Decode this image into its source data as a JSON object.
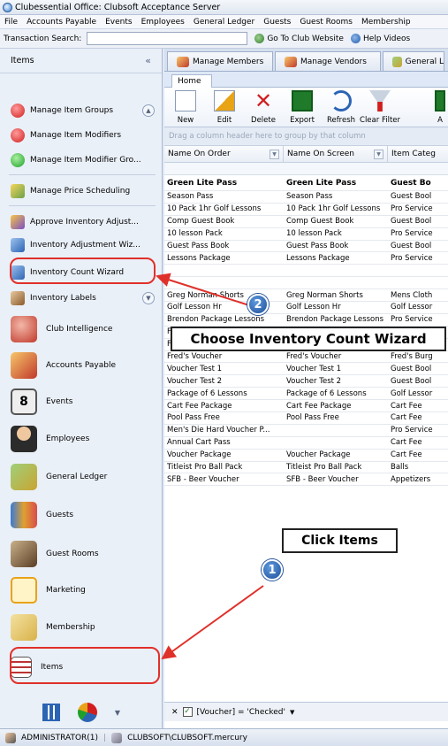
{
  "window": {
    "title": "Clubessential Office: Clubsoft Acceptance Server"
  },
  "menu": [
    "File",
    "Accounts Payable",
    "Events",
    "Employees",
    "General Ledger",
    "Guests",
    "Guest Rooms",
    "Membership"
  ],
  "toolbar": {
    "transaction_search_label": "Transaction Search:",
    "transaction_search_value": "",
    "go_to_website": "Go To Club Website",
    "help_videos": "Help Videos"
  },
  "sidebar": {
    "header": "Items",
    "collapse_glyph": "«",
    "items": [
      {
        "label": "Manage Item Groups",
        "icon": "red-circle-icon"
      },
      {
        "label": "Manage Item Modifiers",
        "icon": "red-circle-icon"
      },
      {
        "label": "Manage Item Modifier Gro...",
        "icon": "green-circle-icon"
      },
      {
        "label": "Manage Price Scheduling",
        "icon": "price-icon"
      },
      {
        "label": "Approve Inventory Adjust...",
        "icon": "pencil-check-icon"
      },
      {
        "label": "Inventory Adjustment Wiz...",
        "icon": "wizard-icon"
      },
      {
        "label": "Inventory Count Wizard",
        "icon": "wizard-icon"
      },
      {
        "label": "Inventory Labels",
        "icon": "label-icon"
      }
    ],
    "groups": [
      {
        "label": "Club Intelligence",
        "icon": "club-intelligence-icon",
        "color": "#c0392b"
      },
      {
        "label": "Accounts Payable",
        "icon": "accounts-payable-icon",
        "color": "#e08a1e"
      },
      {
        "label": "Events",
        "icon": "events-calendar-icon",
        "color": "#6b6b6b"
      },
      {
        "label": "Employees",
        "icon": "employees-icon",
        "color": "#2b2b2b"
      },
      {
        "label": "General Ledger",
        "icon": "general-ledger-icon",
        "color": "#c9a431"
      },
      {
        "label": "Guests",
        "icon": "guests-icon",
        "color": "#3a7bd5"
      },
      {
        "label": "Guest Rooms",
        "icon": "guest-rooms-icon",
        "color": "#7a5a3a"
      },
      {
        "label": "Marketing",
        "icon": "marketing-icon",
        "color": "#e8a317"
      },
      {
        "label": "Membership",
        "icon": "membership-icon",
        "color": "#d9b24a"
      },
      {
        "label": "Items",
        "icon": "items-icon",
        "color": "#8a6a4a"
      }
    ]
  },
  "doc_tabs": [
    "Manage Members",
    "Manage Vendors",
    "General L"
  ],
  "ribbon": {
    "tab": "Home",
    "buttons": [
      "New",
      "Edit",
      "Delete",
      "Export",
      "Refresh",
      "Clear Filter",
      "A"
    ]
  },
  "grid": {
    "group_hint": "Drag a column header here to group by that column",
    "columns": [
      "Name On Order",
      "Name On Screen",
      "Item Categ"
    ],
    "header_row": [
      "Green Lite Pass",
      "Green Lite Pass",
      "Guest Bo"
    ],
    "rows": [
      [
        "Season Pass",
        "Season Pass",
        "Guest Bool"
      ],
      [
        "10 Pack 1hr Golf Lessons",
        "10 Pack 1hr Golf Lessons",
        "Pro Service"
      ],
      [
        "Comp Guest Book",
        "Comp Guest Book",
        "Guest Bool"
      ],
      [
        "10 lesson Pack",
        "10 lesson Pack",
        "Pro Service"
      ],
      [
        "Guest Pass Book",
        "Guest Pass Book",
        "Guest Bool"
      ],
      [
        "Lessons Package",
        "Lessons Package",
        "Pro Service"
      ],
      [
        "",
        "",
        ""
      ],
      [
        "",
        "",
        ""
      ],
      [
        "Greg Norman Shorts",
        "Greg Norman Shorts",
        "Mens Cloth"
      ],
      [
        "Golf Lesson Hr",
        "Golf Lesson Hr",
        "Golf Lessor"
      ],
      [
        "Brendon Package Lessons",
        "Brendon Package Lessons",
        "Pro Service"
      ],
      [
        "Fitness Classes - Pkg 10",
        "Fitness Classes - Pkg 10",
        "Fitness"
      ],
      [
        "Fitness Class - Pkg 20",
        "Fitness Class - Pkg 20",
        "Fitness"
      ],
      [
        "Fred's Voucher",
        "Fred's Voucher",
        "Fred's Burg"
      ],
      [
        "Voucher Test 1",
        "Voucher Test 1",
        "Guest Bool"
      ],
      [
        "Voucher Test 2",
        "Voucher Test 2",
        "Guest Bool"
      ],
      [
        "Package of 6 Lessons",
        "Package of 6 Lessons",
        "Golf Lessor"
      ],
      [
        "Cart Fee Package",
        "Cart Fee Package",
        "Cart Fee"
      ],
      [
        "Pool Pass Free",
        "Pool Pass Free",
        "Cart Fee"
      ],
      [
        "Men's Die Hard Voucher P...",
        "",
        "Pro Service"
      ],
      [
        "Annual Cart Pass",
        "",
        "Cart Fee"
      ],
      [
        "Voucher Package",
        "Voucher Package",
        "Cart Fee"
      ],
      [
        "Titleist Pro Ball Pack",
        "Titleist Pro Ball Pack",
        "Balls"
      ],
      [
        "SFB - Beer Voucher",
        "SFB - Beer Voucher",
        "Appetizers"
      ]
    ],
    "filter_expression": "[Voucher] = 'Checked'"
  },
  "status": {
    "user": "ADMINISTRATOR(1)",
    "server": "CLUBSOFT\\CLUBSOFT.mercury"
  },
  "annotations": {
    "step1_number": "1",
    "step1_text": "Click Items",
    "step2_number": "2",
    "step2_text": "Choose Inventory Count Wizard",
    "highlight_color": "#e0302a"
  }
}
